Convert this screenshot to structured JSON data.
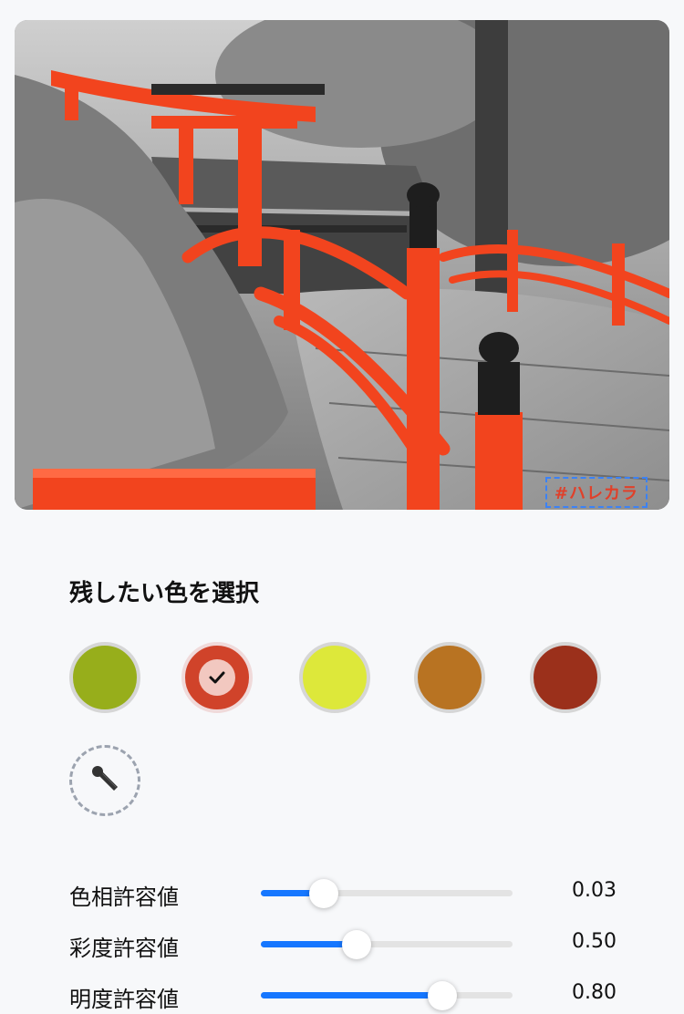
{
  "photo": {
    "watermark": "#ハレカラ"
  },
  "color_section": {
    "title": "残したい色を選択",
    "swatches": [
      {
        "color": "#97ae1b",
        "selected": false
      },
      {
        "color": "#d0432a",
        "selected": true
      },
      {
        "color": "#dde83a",
        "selected": false
      },
      {
        "color": "#b87322",
        "selected": false
      },
      {
        "color": "#9b301b",
        "selected": false
      }
    ],
    "selected_check_icon": "check-icon",
    "picker_icon": "eyedropper-icon"
  },
  "sliders": [
    {
      "label": "色相許容値",
      "value": 0.03,
      "display": "0.03",
      "position": 0.25
    },
    {
      "label": "彩度許容値",
      "value": 0.5,
      "display": "0.50",
      "position": 0.38
    },
    {
      "label": "明度許容値",
      "value": 0.8,
      "display": "0.80",
      "position": 0.72
    }
  ],
  "colors": {
    "accent": "#1677ff",
    "background": "#f7f8fa"
  }
}
